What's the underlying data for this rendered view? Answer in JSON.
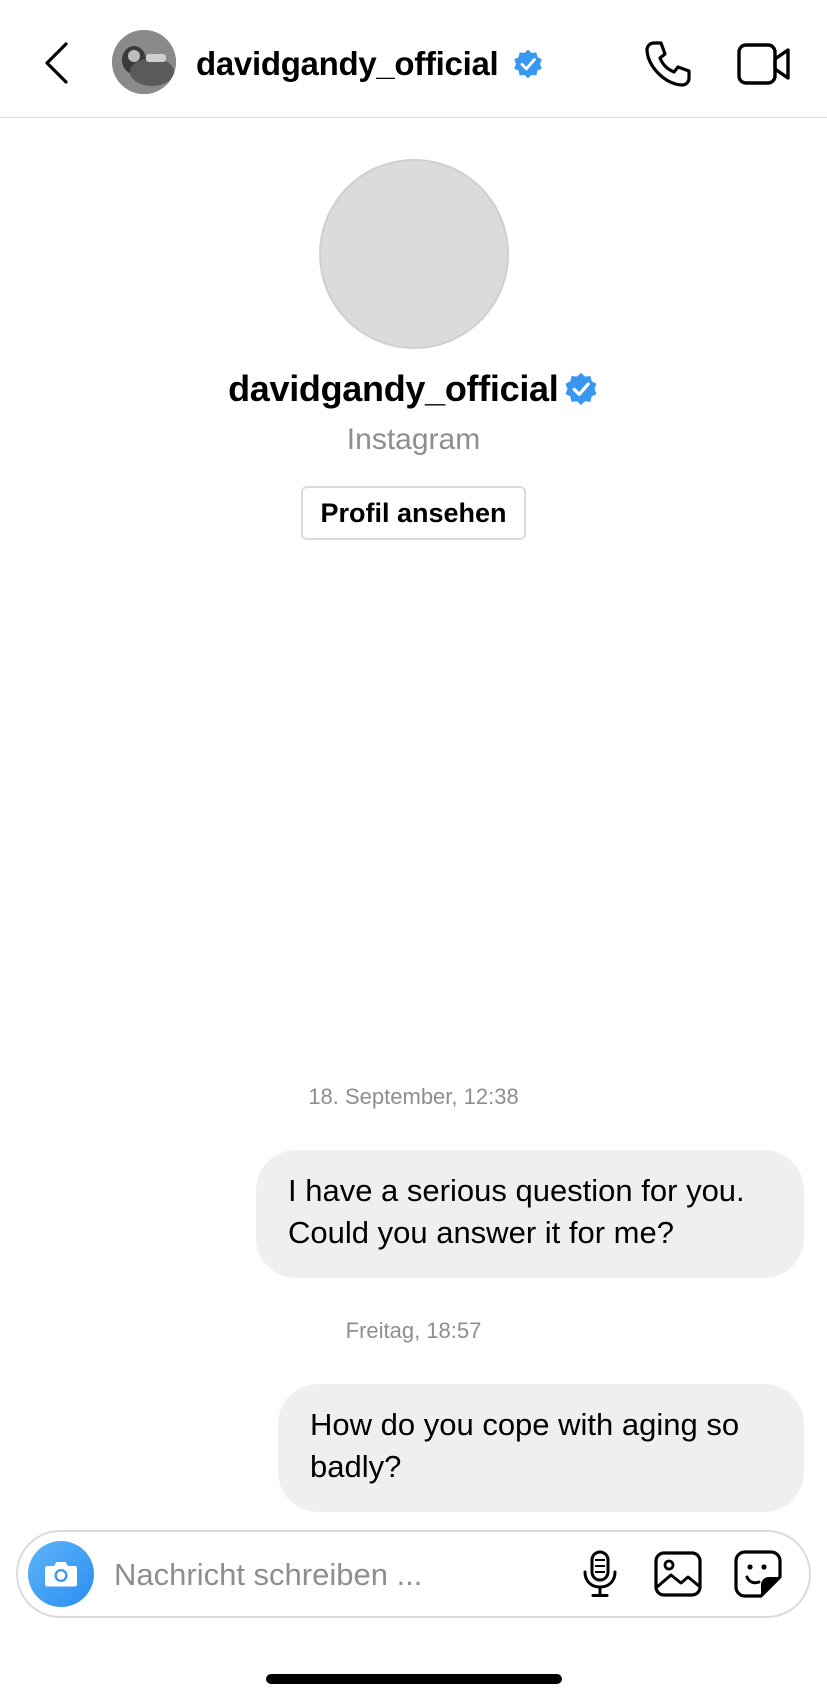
{
  "header": {
    "username": "davidgandy_official",
    "verified": true
  },
  "profile": {
    "username": "davidgandy_official",
    "subtitle": "Instagram",
    "view_profile_label": "Profil ansehen"
  },
  "messages": [
    {
      "timestamp": "18. September, 12:38",
      "text": "I have a serious question for you. Could you answer it for me?"
    },
    {
      "timestamp": "Freitag, 18:57",
      "text": "How do you cope with aging so badly?"
    }
  ],
  "composer": {
    "placeholder": "Nachricht schreiben ..."
  },
  "colors": {
    "verified_blue": "#3897f0",
    "bubble_bg": "#efefef",
    "camera_blue": "#3797f0",
    "muted_text": "#8e8e8e"
  },
  "icons": [
    "back-arrow-icon",
    "verified-badge-icon",
    "phone-icon",
    "video-camera-icon",
    "camera-icon",
    "microphone-icon",
    "gallery-icon",
    "sticker-icon"
  ]
}
